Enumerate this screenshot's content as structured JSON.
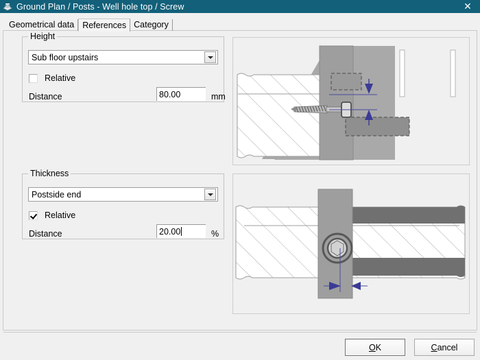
{
  "window": {
    "title": "Ground Plan / Posts - Well hole top / Screw",
    "icon": "app-icon",
    "close_label": "✕",
    "titlebar_color": "#13607a"
  },
  "tabs": [
    {
      "label": "Geometrical data",
      "selected": false
    },
    {
      "label": "References",
      "selected": true
    },
    {
      "label": "Category",
      "selected": false
    }
  ],
  "height_group": {
    "legend": "Height",
    "reference": "Sub floor upstairs",
    "relative_label": "Relative",
    "relative_checked": false,
    "distance_label": "Distance",
    "distance_value": "80.00",
    "unit": "mm"
  },
  "thickness_group": {
    "legend": "Thickness",
    "reference": "Postside end",
    "relative_label": "Relative",
    "relative_checked": true,
    "distance_label": "Distance",
    "distance_value": "20.00",
    "unit": "%"
  },
  "previews": {
    "top": "screw-section-elevation-preview",
    "bottom": "screw-plan-view-preview"
  },
  "footer": {
    "ok_label": "OK",
    "ok_accel": "O",
    "cancel_label": "Cancel",
    "cancel_accel": "C"
  }
}
